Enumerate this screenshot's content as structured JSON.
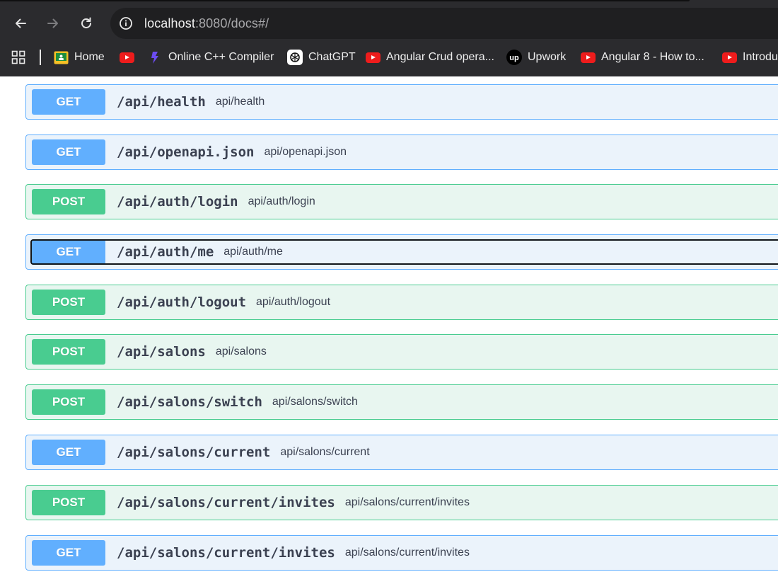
{
  "browser": {
    "url_host": "localhost",
    "url_rest": ":8080/docs#/",
    "bookmarks": [
      {
        "label": "Home",
        "icon": "classroom-icon"
      },
      {
        "label": "",
        "icon": "youtube-icon"
      },
      {
        "label": "Online C++ Compiler",
        "icon": "compiler-icon"
      },
      {
        "label": "ChatGPT",
        "icon": "openai-icon"
      },
      {
        "label": "Angular Crud opera...",
        "icon": "youtube-icon"
      },
      {
        "label": "Upwork",
        "icon": "upwork-icon"
      },
      {
        "label": "Angular 8 - How to...",
        "icon": "youtube-icon"
      },
      {
        "label": "Introdu",
        "icon": "youtube-icon"
      }
    ]
  },
  "colors": {
    "get": "#61affe",
    "post": "#49cc90",
    "get_bg": "#ebf3fb",
    "post_bg": "#e8f6f0",
    "youtube": "#ee1c1c"
  },
  "operations": [
    {
      "method": "GET",
      "path": "/api/health",
      "summary": "api/health"
    },
    {
      "method": "GET",
      "path": "/api/openapi.json",
      "summary": "api/openapi.json"
    },
    {
      "method": "POST",
      "path": "/api/auth/login",
      "summary": "api/auth/login"
    },
    {
      "method": "GET",
      "path": "/api/auth/me",
      "summary": "api/auth/me"
    },
    {
      "method": "POST",
      "path": "/api/auth/logout",
      "summary": "api/auth/logout"
    },
    {
      "method": "POST",
      "path": "/api/salons",
      "summary": "api/salons"
    },
    {
      "method": "POST",
      "path": "/api/salons/switch",
      "summary": "api/salons/switch"
    },
    {
      "method": "GET",
      "path": "/api/salons/current",
      "summary": "api/salons/current"
    },
    {
      "method": "POST",
      "path": "/api/salons/current/invites",
      "summary": "api/salons/current/invites"
    },
    {
      "method": "GET",
      "path": "/api/salons/current/invites",
      "summary": "api/salons/current/invites"
    }
  ]
}
